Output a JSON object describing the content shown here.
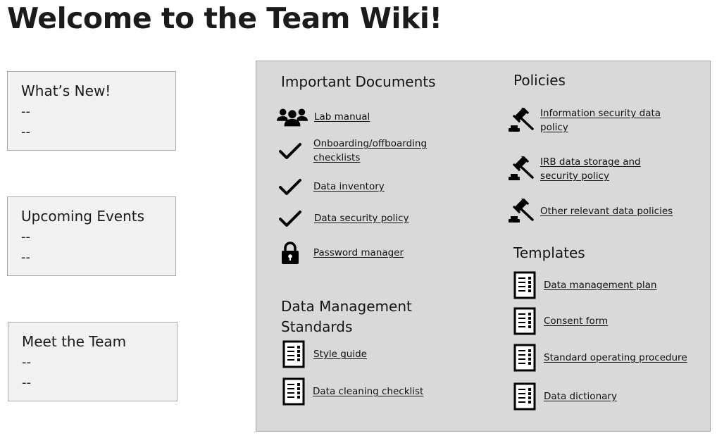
{
  "page": {
    "title": "Welcome to the Team Wiki!"
  },
  "sidebar": {
    "cards": [
      {
        "title": "What’s New!",
        "lines": [
          "--",
          "--"
        ]
      },
      {
        "title": "Upcoming Events",
        "lines": [
          "--",
          "--"
        ]
      },
      {
        "title": "Meet the Team",
        "lines": [
          "--",
          "--"
        ]
      }
    ]
  },
  "important_documents": {
    "title": "Important Documents",
    "items": [
      {
        "label": "Lab manual",
        "icon": "people-icon"
      },
      {
        "label": "Onboarding/offboarding checklists",
        "icon": "checkmark-icon"
      },
      {
        "label": "Data inventory",
        "icon": "checkmark-icon"
      },
      {
        "label": "Data security policy",
        "icon": "checkmark-icon"
      },
      {
        "label": "Password manager",
        "icon": "lock-icon"
      }
    ]
  },
  "data_management_standards": {
    "title": "Data Management Standards",
    "items": [
      {
        "label": "Style guide",
        "icon": "checklist-document-icon"
      },
      {
        "label": "Data cleaning checklist",
        "icon": "checklist-document-icon"
      }
    ]
  },
  "policies": {
    "title": "Policies",
    "items": [
      {
        "label": "Information security data policy",
        "icon": "gavel-icon"
      },
      {
        "label": "IRB data storage and security policy",
        "icon": "gavel-icon"
      },
      {
        "label": "Other relevant data policies",
        "icon": "gavel-icon"
      }
    ]
  },
  "templates": {
    "title": "Templates",
    "items": [
      {
        "label": "Data management plan",
        "icon": "checklist-document-icon"
      },
      {
        "label": "Consent form",
        "icon": "checklist-document-icon"
      },
      {
        "label": "Standard operating procedure",
        "icon": "checklist-document-icon"
      },
      {
        "label": "Data dictionary",
        "icon": "checklist-document-icon"
      }
    ]
  }
}
